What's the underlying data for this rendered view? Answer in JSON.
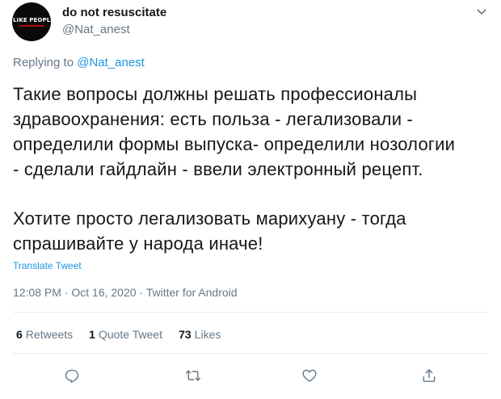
{
  "author": {
    "display_name": "do not resuscitate",
    "handle": "@Nat_anest",
    "avatar_text": "I LIKE PEOPLE"
  },
  "reply": {
    "prefix": "Replying to",
    "mention": "@Nat_anest"
  },
  "tweet": {
    "lines_1": [
      "Такие вопросы должны решать профессионалы",
      "здравоохранения: есть польза - легализовали -",
      "определили формы выпуска- определили нозологии",
      "- сделали гайдлайн - ввели электронный рецепт."
    ],
    "lines_2": [
      "Хотите просто легализовать марихуану - тогда",
      "спрашивайте у народа иначе!"
    ],
    "translate_label": "Translate Tweet"
  },
  "meta": {
    "text": "12:08 PM · Oct 16, 2020 · Twitter for Android"
  },
  "stats": {
    "retweets_count": "6",
    "retweets_label": "Retweets",
    "quote_count": "1",
    "quote_label": "Quote Tweet",
    "likes_count": "73",
    "likes_label": "Likes"
  },
  "actions": {
    "icons": [
      "reply-icon",
      "retweet-icon",
      "like-icon",
      "share-icon"
    ]
  },
  "colors": {
    "link": "#1b95e0",
    "secondary_text": "#657786",
    "primary_text": "#14171a",
    "divider": "#e6ecf0"
  }
}
